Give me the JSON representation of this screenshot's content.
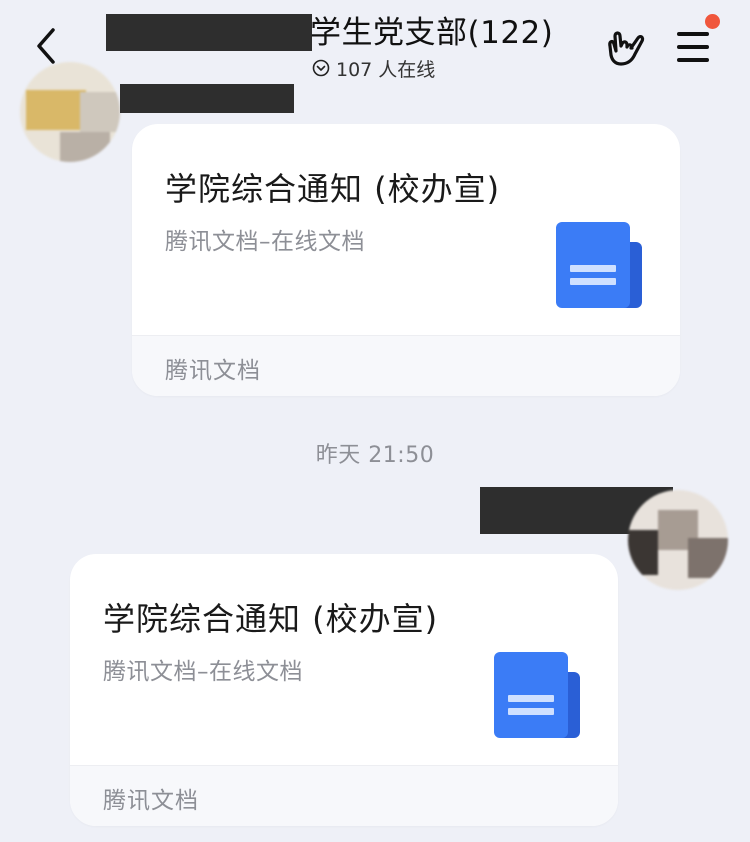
{
  "header": {
    "title": "学生党支部(122)",
    "online_text": "107 人在线"
  },
  "messages": [
    {
      "card": {
        "title": "学院综合通知 (校办宣)",
        "subtitle": "腾讯文档–在线文档",
        "footer": "腾讯文档"
      }
    },
    {
      "card": {
        "title": "学院综合通知 (校办宣)",
        "subtitle": "腾讯文档–在线文档",
        "footer": "腾讯文档"
      }
    }
  ],
  "timestamp": "昨天 21:50",
  "icons": {
    "back": "chevron-left-icon",
    "online": "chevron-down-circle-icon",
    "hand": "hand-gesture-icon",
    "menu": "menu-icon",
    "document": "tencent-doc-icon"
  },
  "colors": {
    "background": "#eef0f7",
    "card": "#ffffff",
    "doc_icon": "#3b7cf6",
    "badge": "#f0563c",
    "redaction": "#2e2e2e"
  }
}
